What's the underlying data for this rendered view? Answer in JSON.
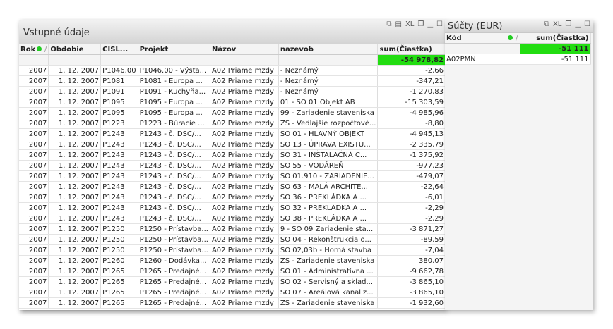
{
  "left": {
    "title": "Vstupné údaje",
    "icons": [
      "copy-icon",
      "print-icon",
      "XL",
      "clone-icon",
      "minimize-icon",
      "maximize-icon"
    ],
    "columns": [
      "Rok",
      "Obdobie",
      "CISL...",
      "Projekt",
      "Názov",
      "nazevob",
      "sum(Čiastka)"
    ],
    "total": "-54 978,82",
    "rows": [
      [
        "2007",
        "1. 12. 2007",
        "P1046.00",
        "P1046.00 - Výsta...",
        "A02 Priame mzdy",
        "- Neznámý",
        "-2,66"
      ],
      [
        "2007",
        "1. 12. 2007",
        "P1081",
        "P1081 - Europa ...",
        "A02 Priame mzdy",
        "- Neznámý",
        "-347,21"
      ],
      [
        "2007",
        "1. 12. 2007",
        "P1091",
        "P1091 - Kuchyňa...",
        "A02 Priame mzdy",
        "- Neznámý",
        "-1 270,83"
      ],
      [
        "2007",
        "1. 12. 2007",
        "P1095",
        "P1095 - Europa ...",
        "A02 Priame mzdy",
        "01 - SO 01 Objekt AB",
        "-15 303,59"
      ],
      [
        "2007",
        "1. 12. 2007",
        "P1095",
        "P1095 - Europa ...",
        "A02 Priame mzdy",
        "99 - Zariadenie staveniska",
        "-4 985,96"
      ],
      [
        "2007",
        "1. 12. 2007",
        "P1223",
        "P1223 - Búracie ...",
        "A02 Priame mzdy",
        "ZS - Vedlajšie rozpočtové...",
        "-8,80"
      ],
      [
        "2007",
        "1. 12. 2007",
        "P1243",
        "P1243 - č. DSC/...",
        "A02 Priame mzdy",
        "SO 01 - HLAVNÝ OBJEKT",
        "-4 945,13"
      ],
      [
        "2007",
        "1. 12. 2007",
        "P1243",
        "P1243 - č. DSC/...",
        "A02 Priame mzdy",
        "SO 13 - ÚPRAVA EXISTU...",
        "-2 335,79"
      ],
      [
        "2007",
        "1. 12. 2007",
        "P1243",
        "P1243 - č. DSC/...",
        "A02 Priame mzdy",
        "SO 31 - INŠTALAČNÁ C...",
        "-1 375,92"
      ],
      [
        "2007",
        "1. 12. 2007",
        "P1243",
        "P1243 - č. DSC/...",
        "A02 Priame mzdy",
        "SO 55 - VODÁREŇ",
        "-977,23"
      ],
      [
        "2007",
        "1. 12. 2007",
        "P1243",
        "P1243 - č. DSC/...",
        "A02 Priame mzdy",
        "SO 01.910 - ZARIADENIE...",
        "-479,07"
      ],
      [
        "2007",
        "1. 12. 2007",
        "P1243",
        "P1243 - č. DSC/...",
        "A02 Priame mzdy",
        "SO 63 - MALÁ ARCHITE...",
        "-22,64"
      ],
      [
        "2007",
        "1. 12. 2007",
        "P1243",
        "P1243 - č. DSC/...",
        "A02 Priame mzdy",
        "SO 36 - PREKLÁDKA A ...",
        "-6,01"
      ],
      [
        "2007",
        "1. 12. 2007",
        "P1243",
        "P1243 - č. DSC/...",
        "A02 Priame mzdy",
        "SO 32 - PREKLÁDKA A ...",
        "-2,29"
      ],
      [
        "2007",
        "1. 12. 2007",
        "P1243",
        "P1243 - č. DSC/...",
        "A02 Priame mzdy",
        "SO 38 - PREKLÁDKA A ...",
        "-2,29"
      ],
      [
        "2007",
        "1. 12. 2007",
        "P1250",
        "P1250 - Prístavba...",
        "A02 Priame mzdy",
        "9 - SO 09 Zariadenie sta...",
        "-3 871,27"
      ],
      [
        "2007",
        "1. 12. 2007",
        "P1250",
        "P1250 - Prístavba...",
        "A02 Priame mzdy",
        "SO 04 - Rekonštrukcia o...",
        "-89,59"
      ],
      [
        "2007",
        "1. 12. 2007",
        "P1250",
        "P1250 - Prístavba...",
        "A02 Priame mzdy",
        "SO 02,03b - Horná stavba",
        "-7,04"
      ],
      [
        "2007",
        "1. 12. 2007",
        "P1260",
        "P1260 - Dodávka...",
        "A02 Priame mzdy",
        "ZS - Zariadenie staveniska",
        "380,07"
      ],
      [
        "2007",
        "1. 12. 2007",
        "P1265",
        "P1265 - Predajné...",
        "A02 Priame mzdy",
        "SO 01 - Administratívna ...",
        "-9 662,78"
      ],
      [
        "2007",
        "1. 12. 2007",
        "P1265",
        "P1265 - Predajné...",
        "A02 Priame mzdy",
        "SO 02 - Servisný a sklad...",
        "-3 865,10"
      ],
      [
        "2007",
        "1. 12. 2007",
        "P1265",
        "P1265 - Predajné...",
        "A02 Priame mzdy",
        "SO 07 - Areálová kanaliz...",
        "-3 865,10"
      ],
      [
        "2007",
        "1. 12. 2007",
        "P1265",
        "P1265 - Predajné...",
        "A02 Priame mzdy",
        "ZS - Zariadenie staveniska",
        "-1 932,60"
      ]
    ]
  },
  "right": {
    "title": "Súčty (EUR)",
    "columns": [
      "Kód",
      "sum(Čiastka)"
    ],
    "total": "-51 111",
    "rows": [
      [
        "A02PMN",
        "-51 111"
      ]
    ]
  },
  "colors": {
    "highlight": "#22dd11"
  }
}
